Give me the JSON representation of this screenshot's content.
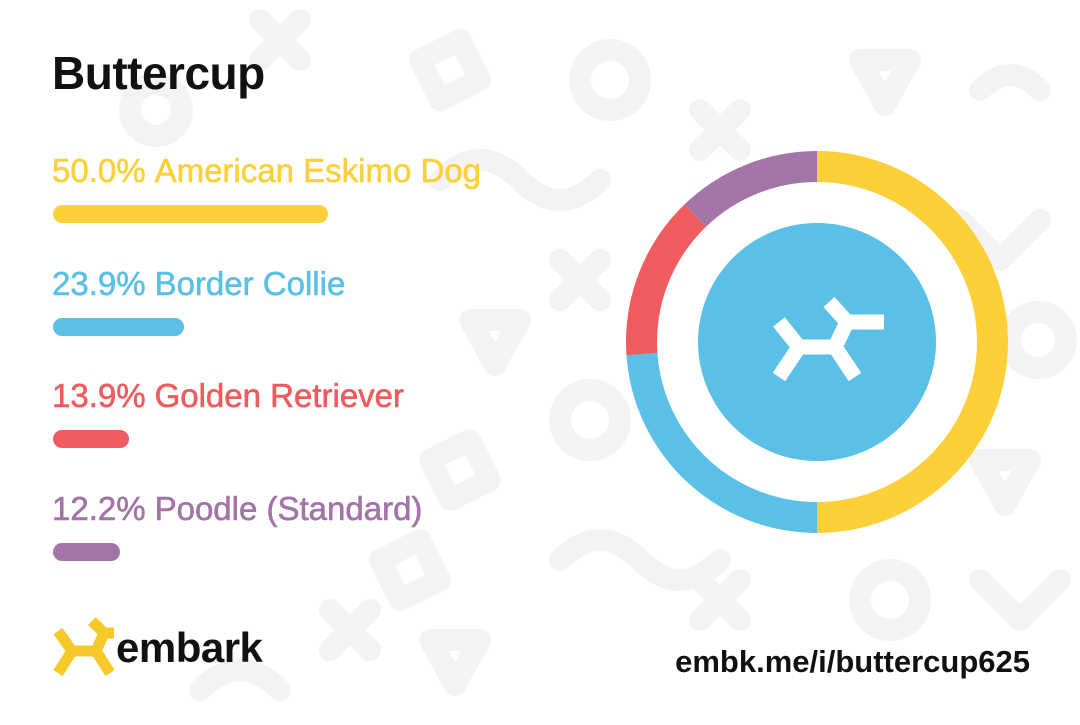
{
  "dog": {
    "name": "Buttercup"
  },
  "chart_data": {
    "type": "pie",
    "series": [
      {
        "name": "American Eskimo Dog",
        "value": 50.0,
        "percent_label": "50.0%",
        "color": "#fdd03a"
      },
      {
        "name": "Border Collie",
        "value": 23.9,
        "percent_label": "23.9%",
        "color": "#5bc0e7"
      },
      {
        "name": "Golden Retriever",
        "value": 13.9,
        "percent_label": "13.9%",
        "color": "#ef5b5e"
      },
      {
        "name": "Poodle (Standard)",
        "value": 12.2,
        "percent_label": "12.2%",
        "color": "#a274a8"
      }
    ]
  },
  "brand": {
    "wordmark": "embark",
    "logo_icon": "embark-dog-icon",
    "logo_color": "#f7c928",
    "center_icon_color": "#5bc0e7"
  },
  "share": {
    "url": "embk.me/i/buttercup625"
  }
}
